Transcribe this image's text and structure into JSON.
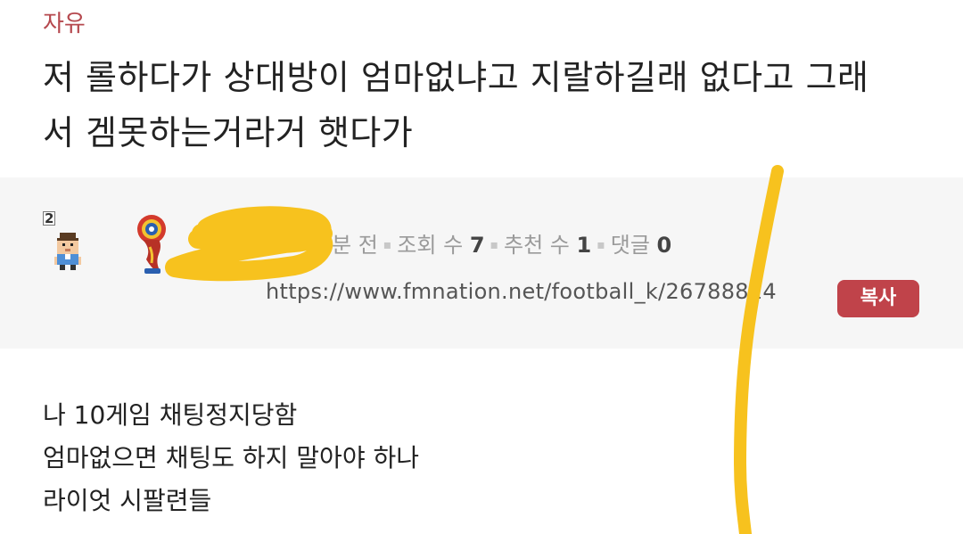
{
  "post": {
    "category": "자유",
    "title_lines": [
      "저 롤하다가 상대방이 엄마없냐고 지랄하길래 없다고 그래",
      "서 겜못하는거라거 햇다가"
    ],
    "body_lines": [
      "나 10게임 채팅정지당함",
      "엄마없으면 채팅도 하지 말아야 하나",
      "라이엇 시팔련들"
    ]
  },
  "meta": {
    "level_badge": "2",
    "time_suffix": "분 전",
    "views_label": "조회 수",
    "views": "7",
    "recommend_label": "추천 수",
    "recommend": "1",
    "comments_label": "댓글",
    "comments": "0",
    "dot": "▪",
    "url": "https://www.fmnation.net/football_k/26788814",
    "copy_label": "복사"
  },
  "icons": {
    "avatar": "pixel-avatar-icon",
    "emblem": "world-cup-emblem-icon"
  },
  "colors": {
    "accent": "#c0434a",
    "category": "#b5484e",
    "scribble": "#f7c21e",
    "meta_bg": "#f6f6f6"
  }
}
